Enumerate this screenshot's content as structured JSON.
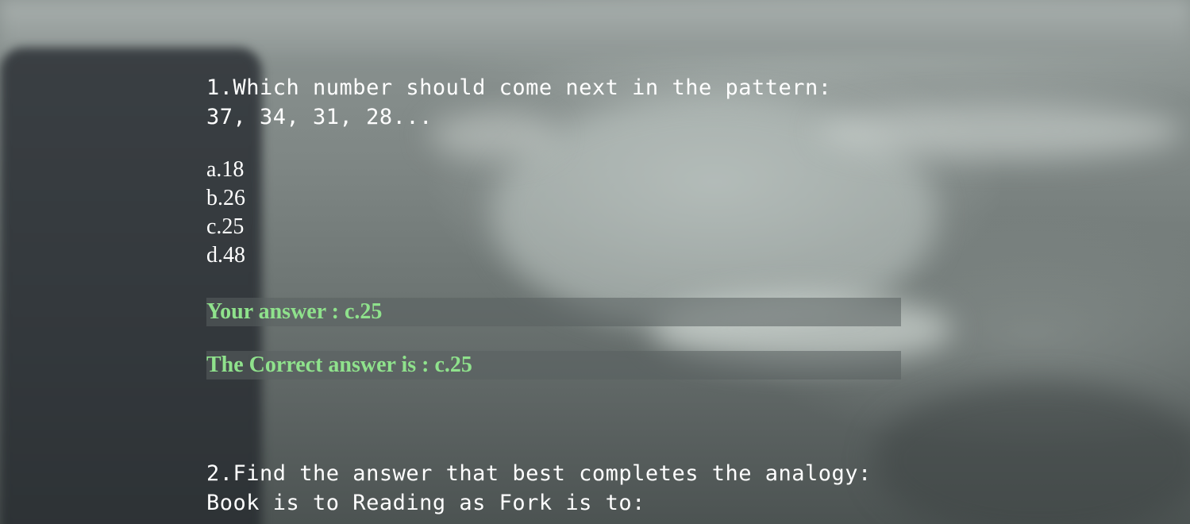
{
  "question1": {
    "line1": "1.Which number should come next in the pattern:",
    "line2": "37, 34, 31, 28...",
    "options": [
      "a.18",
      "b.26",
      "c.25",
      "d.48"
    ],
    "your_answer": "Your answer : c.25",
    "correct_answer": "The Correct answer is : c.25"
  },
  "question2": {
    "line1": "2.Find the answer that best completes the analogy:",
    "line2": "Book is to Reading as Fork is to:"
  },
  "colors": {
    "answer_text": "#8fe28c",
    "text": "#ffffff"
  }
}
